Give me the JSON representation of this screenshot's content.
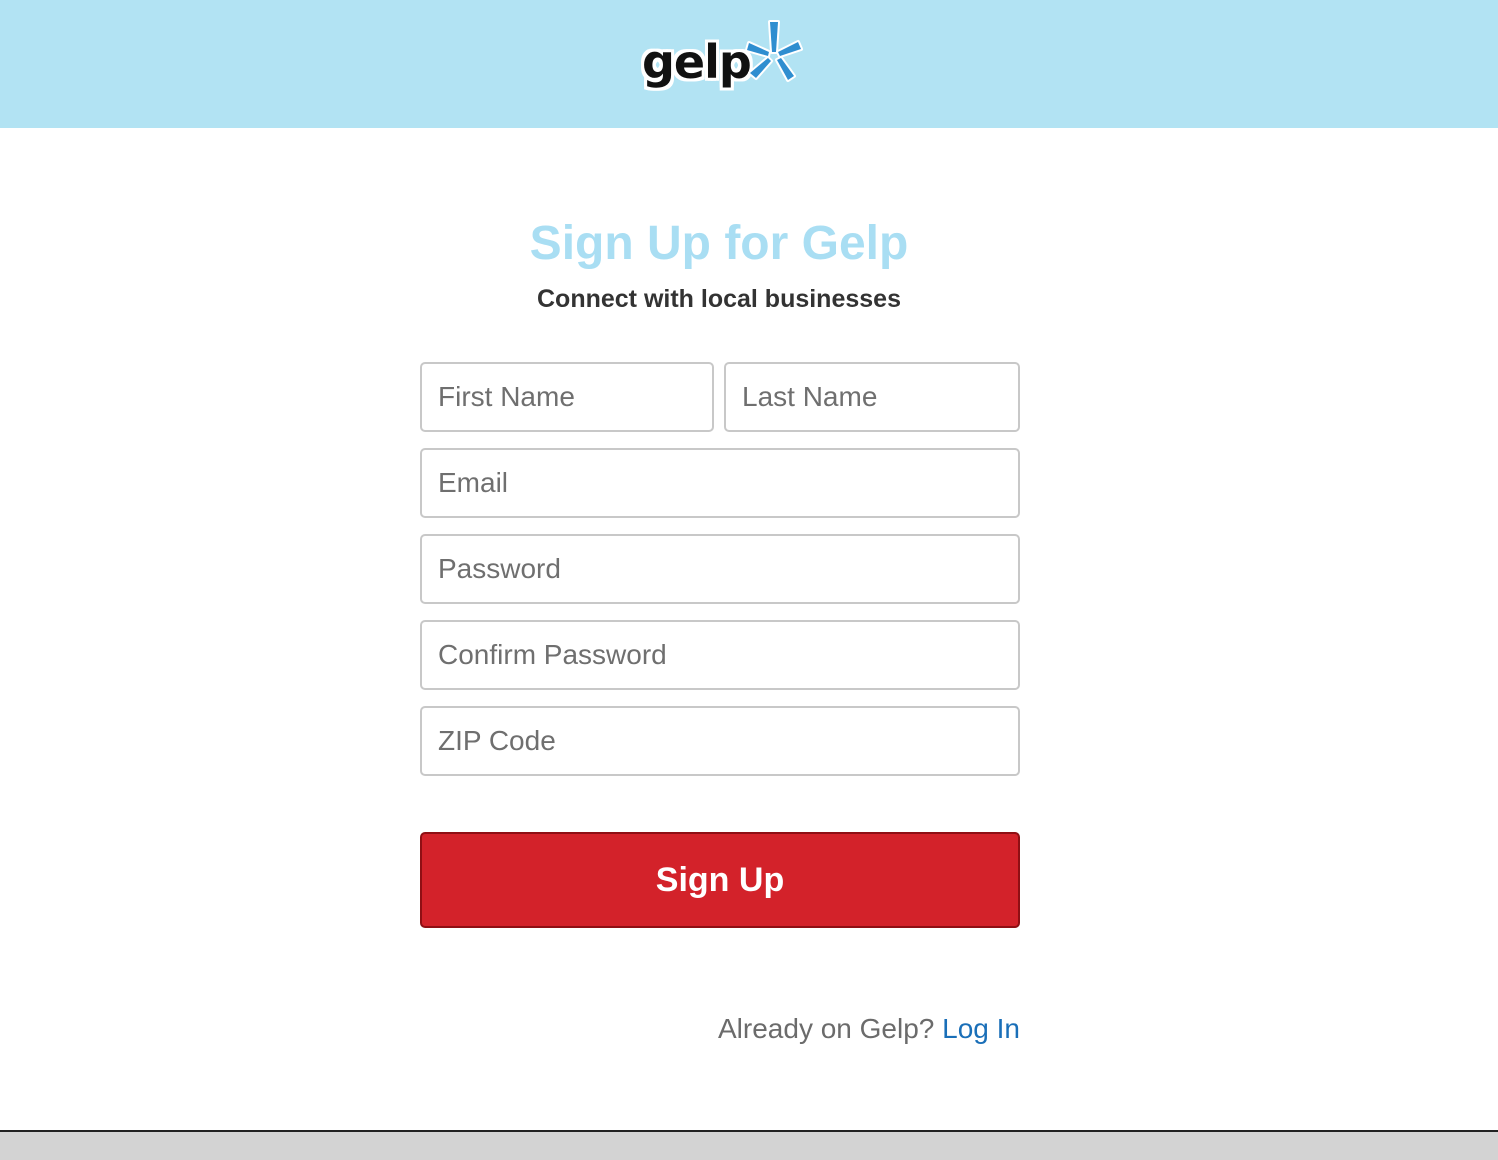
{
  "header": {
    "logo_text": "gelp",
    "background_color": "#b2e3f3",
    "logo_icon": "burst-icon"
  },
  "main": {
    "title": "Sign Up for Gelp",
    "subtitle": "Connect with local businesses"
  },
  "form": {
    "first_name": {
      "placeholder": "First Name",
      "value": ""
    },
    "last_name": {
      "placeholder": "Last Name",
      "value": ""
    },
    "email": {
      "placeholder": "Email",
      "value": ""
    },
    "password": {
      "placeholder": "Password",
      "value": ""
    },
    "confirm_password": {
      "placeholder": "Confirm Password",
      "value": ""
    },
    "zip_code": {
      "placeholder": "ZIP Code",
      "value": ""
    },
    "submit_label": "Sign Up",
    "submit_color": "#d3222a"
  },
  "login_prompt": {
    "text": "Already on Gelp?",
    "link_label": "Log In",
    "link_color": "#1a6fb8"
  }
}
